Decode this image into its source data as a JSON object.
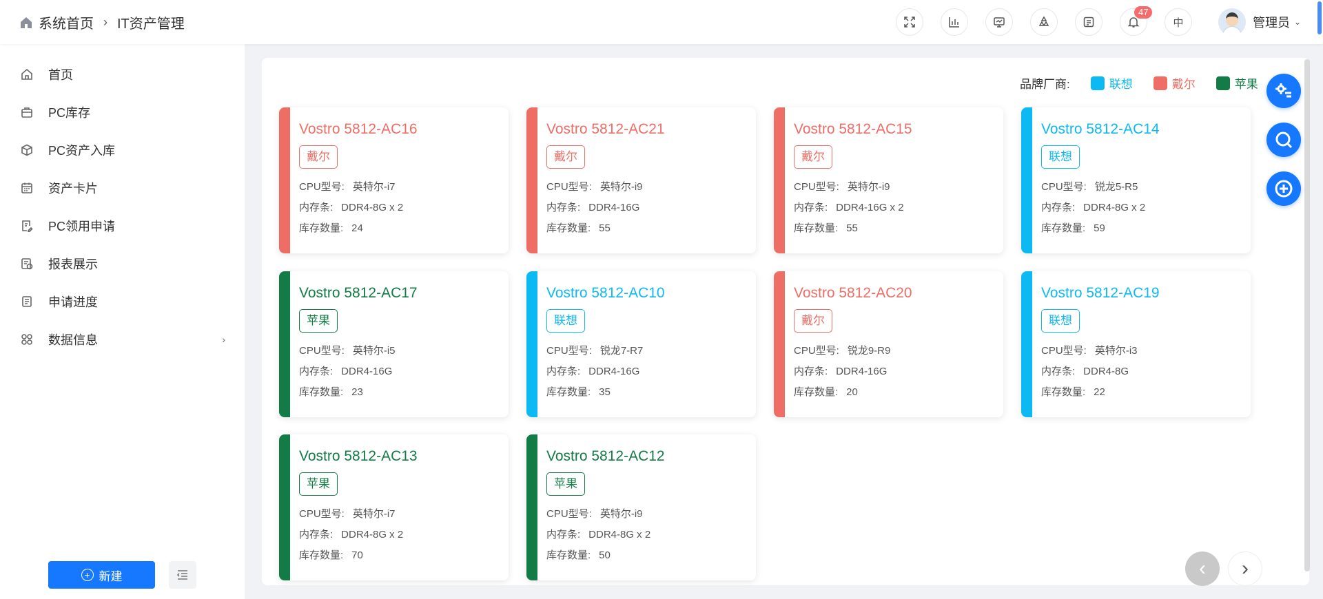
{
  "header": {
    "breadcrumb": [
      "系统首页",
      "IT资产管理"
    ],
    "tools": [
      {
        "icon": "fullscreen-icon"
      },
      {
        "icon": "bar-chart-icon"
      },
      {
        "icon": "monitor-icon"
      },
      {
        "icon": "recycle-icon"
      },
      {
        "icon": "form-icon"
      },
      {
        "icon": "bell-icon",
        "badge": "47"
      },
      {
        "label": "中"
      }
    ],
    "user": {
      "name": "管理员"
    }
  },
  "sidebar": {
    "items": [
      {
        "label": "首页",
        "icon": "home-icon"
      },
      {
        "label": "PC库存",
        "icon": "briefcase-icon"
      },
      {
        "label": "PC资产入库",
        "icon": "box-icon"
      },
      {
        "label": "资产卡片",
        "icon": "calendar-icon"
      },
      {
        "label": "PC领用申请",
        "icon": "document-edit-icon"
      },
      {
        "label": "报表展示",
        "icon": "report-icon"
      },
      {
        "label": "申请进度",
        "icon": "checklist-icon"
      },
      {
        "label": "数据信息",
        "icon": "grid-icon",
        "has_children": true
      }
    ],
    "new_button": "新建"
  },
  "legend": {
    "label": "品牌厂商:",
    "items": [
      {
        "name": "联想",
        "color": "#0db9f2"
      },
      {
        "name": "戴尔",
        "color": "#ee6e66"
      },
      {
        "name": "苹果",
        "color": "#137b45"
      }
    ]
  },
  "field_labels": {
    "cpu": "CPU型号:",
    "memory": "内存条:",
    "stock": "库存数量:"
  },
  "cards": [
    {
      "title": "Vostro 5812-AC16",
      "brand": "戴尔",
      "color": "#ee6e66",
      "cpu": "英特尔-i7",
      "memory": "DDR4-8G x 2",
      "stock": "24"
    },
    {
      "title": "Vostro 5812-AC21",
      "brand": "戴尔",
      "color": "#ee6e66",
      "cpu": "英特尔-i9",
      "memory": "DDR4-16G",
      "stock": "55"
    },
    {
      "title": "Vostro 5812-AC15",
      "brand": "戴尔",
      "color": "#ee6e66",
      "cpu": "英特尔-i9",
      "memory": "DDR4-16G x 2",
      "stock": "55"
    },
    {
      "title": "Vostro 5812-AC14",
      "brand": "联想",
      "color": "#0db9f2",
      "cpu": "锐龙5-R5",
      "memory": "DDR4-8G x 2",
      "stock": "59"
    },
    {
      "title": "Vostro 5812-AC17",
      "brand": "苹果",
      "color": "#137b45",
      "cpu": "英特尔-i5",
      "memory": "DDR4-16G",
      "stock": "23"
    },
    {
      "title": "Vostro 5812-AC10",
      "brand": "联想",
      "color": "#0db9f2",
      "cpu": "锐龙7-R7",
      "memory": "DDR4-16G",
      "stock": "35"
    },
    {
      "title": "Vostro 5812-AC20",
      "brand": "戴尔",
      "color": "#ee6e66",
      "cpu": "锐龙9-R9",
      "memory": "DDR4-16G",
      "stock": "20"
    },
    {
      "title": "Vostro 5812-AC19",
      "brand": "联想",
      "color": "#0db9f2",
      "cpu": "英特尔-i3",
      "memory": "DDR4-8G",
      "stock": "22"
    },
    {
      "title": "Vostro 5812-AC13",
      "brand": "苹果",
      "color": "#137b45",
      "cpu": "英特尔-i7",
      "memory": "DDR4-8G x 2",
      "stock": "70"
    },
    {
      "title": "Vostro 5812-AC12",
      "brand": "苹果",
      "color": "#137b45",
      "cpu": "英特尔-i9",
      "memory": "DDR4-8G x 2",
      "stock": "50"
    }
  ],
  "fabs": [
    {
      "icon": "settings-panel-icon"
    },
    {
      "icon": "search-icon"
    },
    {
      "icon": "add-circle-icon"
    }
  ],
  "pager": {
    "prev": "‹",
    "next": "›"
  }
}
